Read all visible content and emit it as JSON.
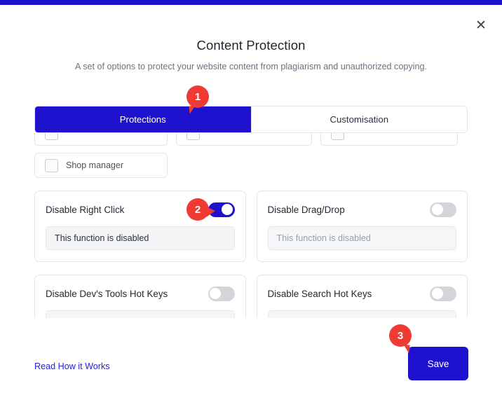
{
  "theme": {
    "accent_blue": "#1e12cf",
    "marker_red": "#ef3b33",
    "link_blue": "#2a20d4",
    "border_grey": "#e3e5ea",
    "field_grey": "#f3f4f6"
  },
  "topbar": {
    "color": "#1e12cf"
  },
  "modal": {
    "close_icon": "close-icon",
    "close_glyph": "✕",
    "title": "Content Protection",
    "subtitle": "A set of options to protect your website content from plagiarism and unauthorized copying."
  },
  "tabs": [
    {
      "label": "Protections",
      "active": true
    },
    {
      "label": "Customisation",
      "active": false
    }
  ],
  "roles": {
    "clipped_row": [
      {
        "label": ""
      },
      {
        "label": ""
      },
      {
        "label": ""
      }
    ],
    "visible_row": [
      {
        "label": "Shop manager",
        "checked": false
      }
    ]
  },
  "cards": [
    {
      "title": "Disable Right Click",
      "toggle_on": true,
      "field_text": "This function is disabled",
      "field_muted": false
    },
    {
      "title": "Disable Drag/Drop",
      "toggle_on": false,
      "field_text": "This function is disabled",
      "field_muted": true
    },
    {
      "title": "Disable Dev's Tools Hot Keys",
      "toggle_on": false,
      "field_text": "",
      "field_muted": true
    },
    {
      "title": "Disable Search Hot Keys",
      "toggle_on": false,
      "field_text": "",
      "field_muted": true
    }
  ],
  "footer": {
    "read_link": "Read How it Works",
    "save_label": "Save"
  },
  "markers": [
    {
      "number": "1"
    },
    {
      "number": "2"
    },
    {
      "number": "3"
    }
  ]
}
